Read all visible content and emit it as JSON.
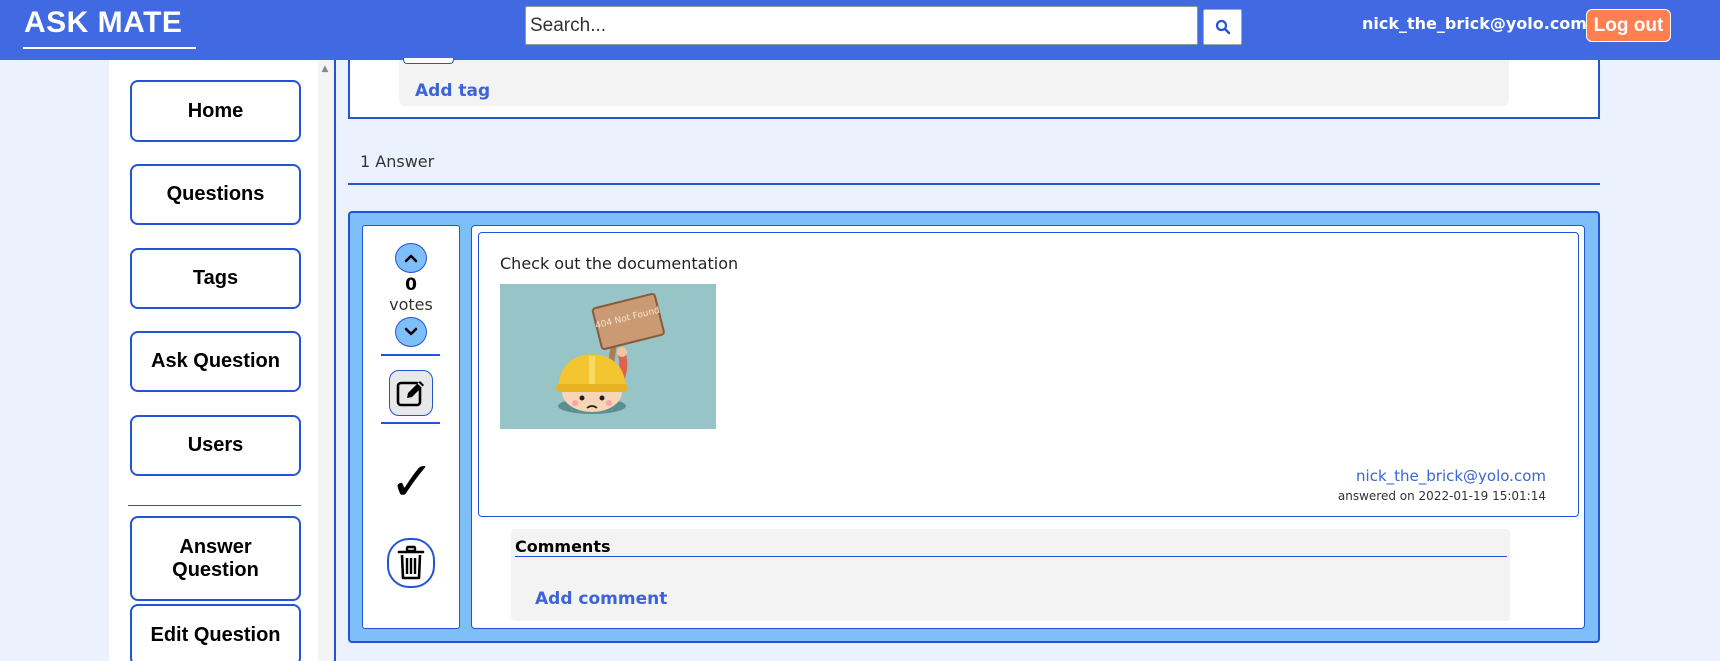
{
  "header": {
    "logo": "ASK MATE",
    "search_placeholder": "Search...",
    "user_email": "nick_the_brick@yolo.com",
    "logout_label": "Log out"
  },
  "sidebar": {
    "items": [
      {
        "label": "Home"
      },
      {
        "label": "Questions"
      },
      {
        "label": "Tags"
      },
      {
        "label": "Ask Question"
      },
      {
        "label": "Users"
      }
    ],
    "actions": [
      {
        "label": "Answer Question"
      },
      {
        "label": "Edit Question"
      }
    ]
  },
  "question": {
    "add_tag_label": "Add tag"
  },
  "answers": {
    "count_label": "1 Answer",
    "items": [
      {
        "votes": "0",
        "votes_label": "votes",
        "accepted_mark": "✓",
        "text": "Check out the documentation",
        "image_sign_text": "404 Not Found",
        "author": "nick_the_brick@yolo.com",
        "answered_on": "answered on 2022-01-19 15:01:14",
        "comments_title": "Comments",
        "add_comment_label": "Add comment"
      }
    ]
  },
  "colors": {
    "header_bg": "#4169e1",
    "accent_border": "#2454d6",
    "answer_card_bg": "#7fbff9",
    "logout_bg": "#ff7f50",
    "link": "#3d63d8",
    "page_bg": "#ecf2fd"
  },
  "icons": {
    "search": "search-icon",
    "upvote": "chevron-up-icon",
    "downvote": "chevron-down-icon",
    "edit": "edit-icon",
    "delete": "trash-icon"
  }
}
